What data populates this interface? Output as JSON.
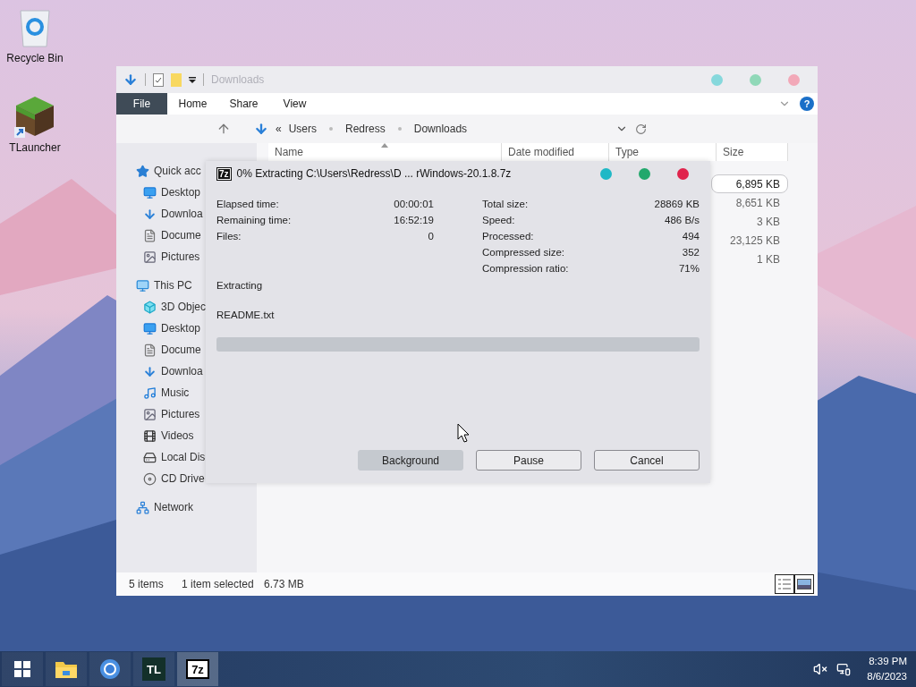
{
  "desktop": {
    "icons": [
      {
        "label": "Recycle Bin",
        "kind": "recycle"
      },
      {
        "label": "TLauncher",
        "kind": "block"
      }
    ]
  },
  "explorer": {
    "title": "Downloads",
    "active": false,
    "ribbon_tabs": [
      {
        "label": "File",
        "selected": true
      },
      {
        "label": "Home",
        "selected": false
      },
      {
        "label": "Share",
        "selected": false
      },
      {
        "label": "View",
        "selected": false
      }
    ],
    "help_mark": "?",
    "back_mark": "«",
    "breadcrumb": [
      "Users",
      "Redress",
      "Downloads"
    ],
    "columns": [
      "Name",
      "Date modified",
      "Type",
      "Size"
    ],
    "sidebar": [
      {
        "label": "Quick acc",
        "kind": "star",
        "children": [
          {
            "label": "Desktop",
            "kind": "desktop"
          },
          {
            "label": "Downloa",
            "kind": "download"
          },
          {
            "label": "Docume",
            "kind": "document"
          },
          {
            "label": "Pictures",
            "kind": "pictures"
          }
        ]
      },
      {
        "label": "This PC",
        "kind": "pc",
        "children": [
          {
            "label": "3D Objec",
            "kind": "cube"
          },
          {
            "label": "Desktop",
            "kind": "desktop"
          },
          {
            "label": "Docume",
            "kind": "document"
          },
          {
            "label": "Downloa",
            "kind": "download"
          },
          {
            "label": "Music",
            "kind": "music"
          },
          {
            "label": "Pictures",
            "kind": "pictures"
          },
          {
            "label": "Videos",
            "kind": "videos"
          },
          {
            "label": "Local Dis",
            "kind": "drive"
          },
          {
            "label": "CD Drive",
            "kind": "cd"
          }
        ]
      },
      {
        "label": "Network",
        "kind": "network"
      }
    ],
    "sizes": [
      {
        "text": "6,895 KB",
        "selected": true
      },
      {
        "text": "8,651 KB",
        "selected": false
      },
      {
        "text": "3 KB",
        "selected": false
      },
      {
        "text": "23,125 KB",
        "selected": false
      },
      {
        "text": "1 KB",
        "selected": false
      }
    ],
    "status": {
      "items": "5 items",
      "selection": "1 item selected",
      "size": "6.73 MB"
    }
  },
  "dialog": {
    "badge": "7z",
    "title": "0% Extracting C:\\Users\\Redress\\D ... rWindows-20.1.8.7z",
    "active": true,
    "left_stats": [
      {
        "label": "Elapsed time:",
        "value": "00:00:01"
      },
      {
        "label": "Remaining time:",
        "value": "16:52:19"
      },
      {
        "label": "Files:",
        "value": "0"
      }
    ],
    "right_stats": [
      {
        "label": "Total size:",
        "value": "28869 KB"
      },
      {
        "label": "Speed:",
        "value": "486 B/s"
      },
      {
        "label": "Processed:",
        "value": "494"
      },
      {
        "label": "Compressed size:",
        "value": "352"
      },
      {
        "label": "Compression ratio:",
        "value": "71%"
      }
    ],
    "action": "Extracting",
    "file": "README.txt",
    "progress": {
      "level": 0
    },
    "buttons": [
      {
        "label": "Background",
        "selected": true
      },
      {
        "label": "Pause",
        "selected": false
      },
      {
        "label": "Cancel",
        "selected": false
      }
    ]
  },
  "taskbar": {
    "apps": [
      {
        "kind": "start"
      },
      {
        "kind": "folder"
      },
      {
        "kind": "browser"
      },
      {
        "kind": "tile",
        "label": "TL",
        "selected": false
      },
      {
        "kind": "badge",
        "label": "7z",
        "selected": true
      }
    ],
    "time": "8:39 PM",
    "date": "8/6/2023"
  }
}
